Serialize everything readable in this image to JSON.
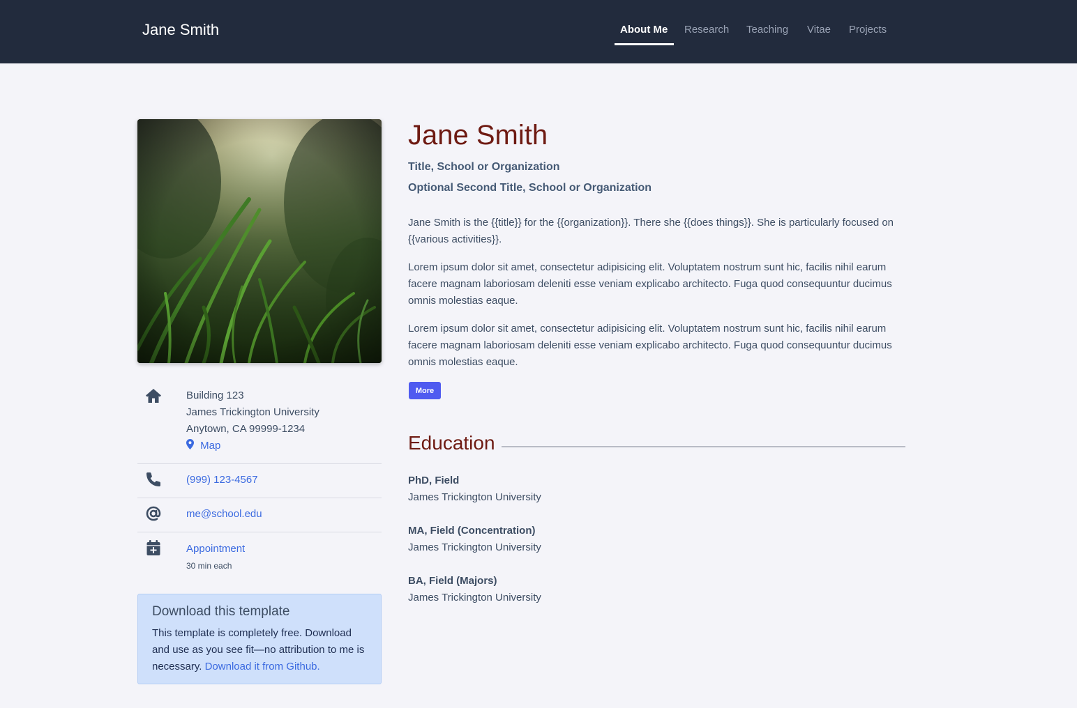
{
  "header": {
    "brand": "Jane Smith",
    "nav": [
      {
        "label": "About Me",
        "active": true
      },
      {
        "label": "Research",
        "active": false
      },
      {
        "label": "Teaching",
        "active": false
      },
      {
        "label": "Vitae",
        "active": false
      },
      {
        "label": "Projects",
        "active": false
      }
    ]
  },
  "profile": {
    "photo_icon": "grass-photo",
    "address": {
      "icon": "home-icon",
      "line1": "Building 123",
      "line2": "James Trickington University",
      "line3": "Anytown, CA 99999-1234",
      "map_icon": "map-pin-icon",
      "map_label": "Map"
    },
    "phone": {
      "icon": "phone-icon",
      "value": "(999) 123-4567"
    },
    "email": {
      "icon": "at-icon",
      "value": "me@school.edu"
    },
    "appointment": {
      "icon": "calendar-plus-icon",
      "label": "Appointment",
      "note": "30 min each"
    }
  },
  "callout": {
    "title": "Download this template",
    "text": "This template is completely free. Download and use as you see fit—no attribution to me is necessary.",
    "link": "Download it from Github."
  },
  "main": {
    "name": "Jane Smith",
    "title1": "Title, School or Organization",
    "title2": "Optional Second Title, School or Organization",
    "paragraphs": [
      "Jane Smith is the {{title}} for the {{organization}}. There she {{does things}}. She is particularly focused on {{various activities}}.",
      "Lorem ipsum dolor sit amet, consectetur adipisicing elit. Voluptatem nostrum sunt hic, facilis nihil earum facere magnam laboriosam deleniti esse veniam explicabo architecto. Fuga quod consequuntur ducimus omnis molestias eaque.",
      "Lorem ipsum dolor sit amet, consectetur adipisicing elit. Voluptatem nostrum sunt hic, facilis nihil earum facere magnam laboriosam deleniti esse veniam explicabo architecto. Fuga quod consequuntur ducimus omnis molestias eaque."
    ],
    "more_label": "More",
    "education_title": "Education",
    "education": [
      {
        "degree": "PhD, Field",
        "school": "James Trickington University"
      },
      {
        "degree": "MA, Field (Concentration)",
        "school": "James Trickington University"
      },
      {
        "degree": "BA, Field (Majors)",
        "school": "James Trickington University"
      }
    ]
  },
  "colors": {
    "topbar": "#222b3d",
    "heading": "#6e1a12",
    "link": "#3b6ae0",
    "button": "#4f5bf0",
    "callout_bg": "#cfe0fb"
  }
}
